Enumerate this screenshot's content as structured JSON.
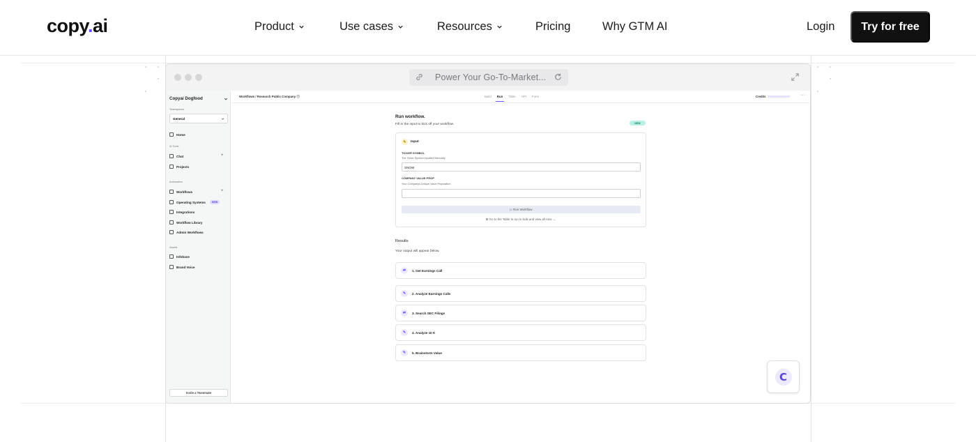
{
  "nav": {
    "logo_prefix": "copy",
    "logo_dot": ".",
    "logo_suffix": "ai",
    "links": [
      "Product",
      "Use cases",
      "Resources",
      "Pricing",
      "Why GTM AI"
    ],
    "login": "Login",
    "cta": "Try for free"
  },
  "browser": {
    "url_text": "Power Your Go-To-Market...",
    "icons": [
      "link-icon",
      "refresh-icon",
      "expand-icon"
    ]
  },
  "sidebar": {
    "workspace": "Copyai Dogfood",
    "teamspaces_label": "Teamspaces",
    "teamspace_value": "General",
    "home": "Home",
    "ai_tools_label": "AI Tools",
    "chat": "Chat",
    "projects": "Projects",
    "automation_label": "Automation",
    "workflows": "Workflows",
    "operating_systems": "Operating Systems",
    "new_badge": "NEW",
    "integrations": "Integrations",
    "workflow_library": "Workflow Library",
    "admin_workflows": "Admin Workflows",
    "assets_label": "Assets",
    "infobase": "Infobase",
    "brand_voice": "Brand Voice",
    "invite": "Invite a Teammate"
  },
  "topbar": {
    "breadcrumb": "Workflows  /  Research Public Company  ⓘ",
    "tabs": [
      "Build",
      "Run",
      "Table",
      "API",
      "Form"
    ],
    "credits": "Credits",
    "more": "···"
  },
  "run": {
    "title": "Run workflow.",
    "subtitle": "Fill in the input to kick off your workflow.",
    "new_pill": "NEW",
    "input_header": "Input",
    "field1_label": "TICKER SYMBOL",
    "field1_desc": "The Ticker Symbol Inputted Manually",
    "field1_value": "SNOW",
    "field2_label": "COMPANY VALUE PROP",
    "field2_desc": "Your Companys Unique Value Proposition",
    "field2_value": "",
    "run_button": "▷ Run Workflow",
    "table_link": "⊞ Go to the Table to run in bulk and view all runs →"
  },
  "results": {
    "title": "Results",
    "subtitle": "Your output will appear below.",
    "steps": [
      {
        "label": "1. Get Earnings Call",
        "icon": "⇄"
      },
      {
        "label": "2. Analyze Earnings Calls",
        "icon": "✎"
      },
      {
        "label": "3. Search SEC Filings",
        "icon": "⇄"
      },
      {
        "label": "4. Analyze 10 K",
        "icon": "✎"
      },
      {
        "label": "5. Brainstorm Value",
        "icon": "✎"
      }
    ]
  },
  "chat_fab": {
    "letter": "C"
  },
  "colors": {
    "accent": "#6d4aff",
    "cta_bg": "#111111",
    "new_pill": "#b9f0e3"
  }
}
